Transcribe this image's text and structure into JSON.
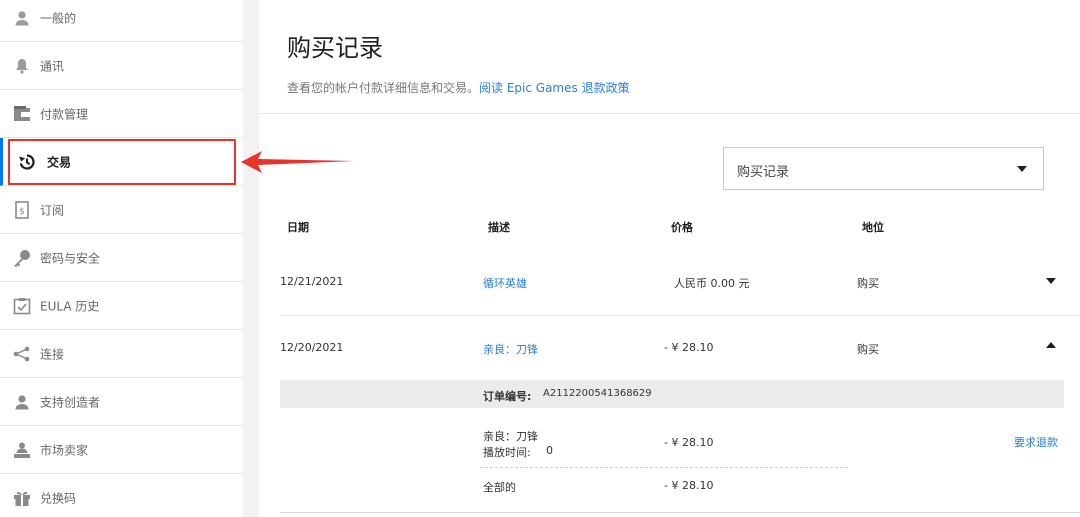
{
  "sidebar": {
    "items": [
      {
        "label": "一般的",
        "icon": "person-icon"
      },
      {
        "label": "通讯",
        "icon": "bell-icon"
      },
      {
        "label": "付款管理",
        "icon": "wallet-icon"
      },
      {
        "label": "交易",
        "icon": "history-icon"
      },
      {
        "label": "订阅",
        "icon": "subscription-icon"
      },
      {
        "label": "密码与安全",
        "icon": "key-icon"
      },
      {
        "label": "EULA 历史",
        "icon": "checklist-icon"
      },
      {
        "label": "连接",
        "icon": "share-icon"
      },
      {
        "label": "支持创造者",
        "icon": "person-icon"
      },
      {
        "label": "市场卖家",
        "icon": "seller-icon"
      },
      {
        "label": "兑换码",
        "icon": "gift-icon"
      }
    ]
  },
  "main": {
    "title": "购买记录",
    "subtitle": "查看您的帐户付款详细信息和交易。",
    "subtitle_link": "阅读 Epic Games 退款政策",
    "filter": {
      "selected": "购买记录"
    },
    "columns": [
      "日期",
      "描述",
      "价格",
      "地位"
    ],
    "rows": [
      {
        "date": "12/21/2021",
        "desc": "循环英雄",
        "price": "人民币 0.00 元",
        "status": "购买"
      },
      {
        "date": "12/20/2021",
        "desc": "亲良：刀锋",
        "price": "- ¥ 28.10",
        "status": "购买"
      }
    ],
    "detail": {
      "order_label": "订单编号:",
      "order_id": "A2112200541368629",
      "item_name": "亲良：刀锋",
      "playtime_label": "播放时间:",
      "playtime_value": "0",
      "item_price": "- ¥ 28.10",
      "refund": "要求退款",
      "total_label": "全部的",
      "total_price": "- ¥ 28.10"
    }
  },
  "colors": {
    "accent": "#2a7fd4",
    "highlight": "#e8322a"
  }
}
